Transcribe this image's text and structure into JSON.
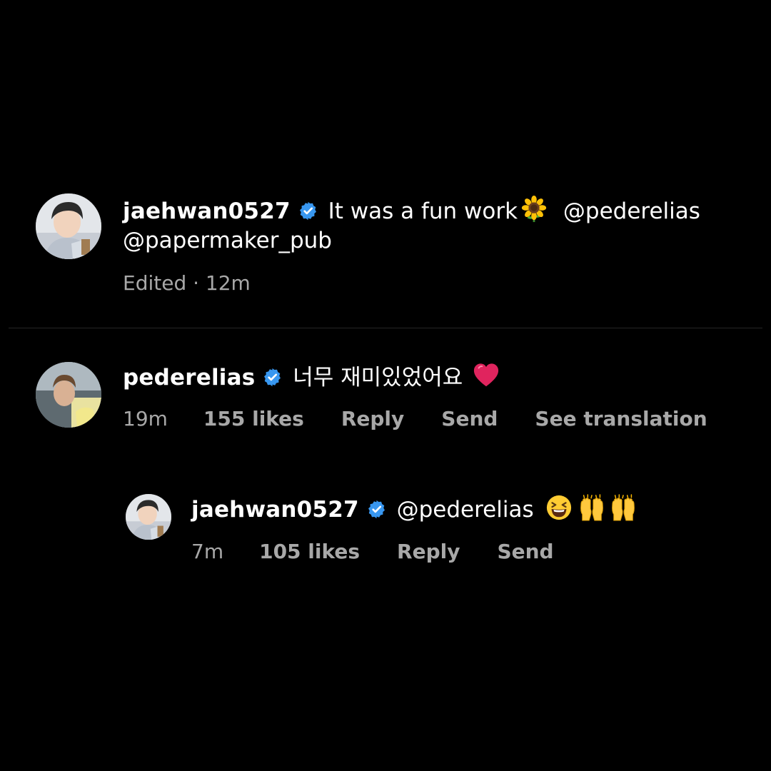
{
  "comments": [
    {
      "username": "jaehwan0527",
      "verified": true,
      "text": "It was a fun work",
      "emoji": "sunflower-emoji",
      "mentions": [
        "@pederelias",
        "@papermaker_pub"
      ],
      "meta": "Edited · 12m"
    },
    {
      "username": "pederelias",
      "verified": true,
      "text": "너무 재미있었어요",
      "emoji": "red-heart-emoji",
      "time": "19m",
      "likes": "155 likes",
      "reply": "Reply",
      "send": "Send",
      "translate": "See translation"
    },
    {
      "username": "jaehwan0527",
      "verified": true,
      "mention": "@pederelias",
      "emojis": [
        "grinning-squinting-face-emoji",
        "raising-hands-emoji",
        "raising-hands-emoji"
      ],
      "time": "7m",
      "likes": "105 likes",
      "reply": "Reply",
      "send": "Send"
    }
  ],
  "colors": {
    "background": "#000000",
    "text": "#ffffff",
    "secondary": "#a8a8a8",
    "verified": "#3897f0",
    "divider": "#262626"
  }
}
